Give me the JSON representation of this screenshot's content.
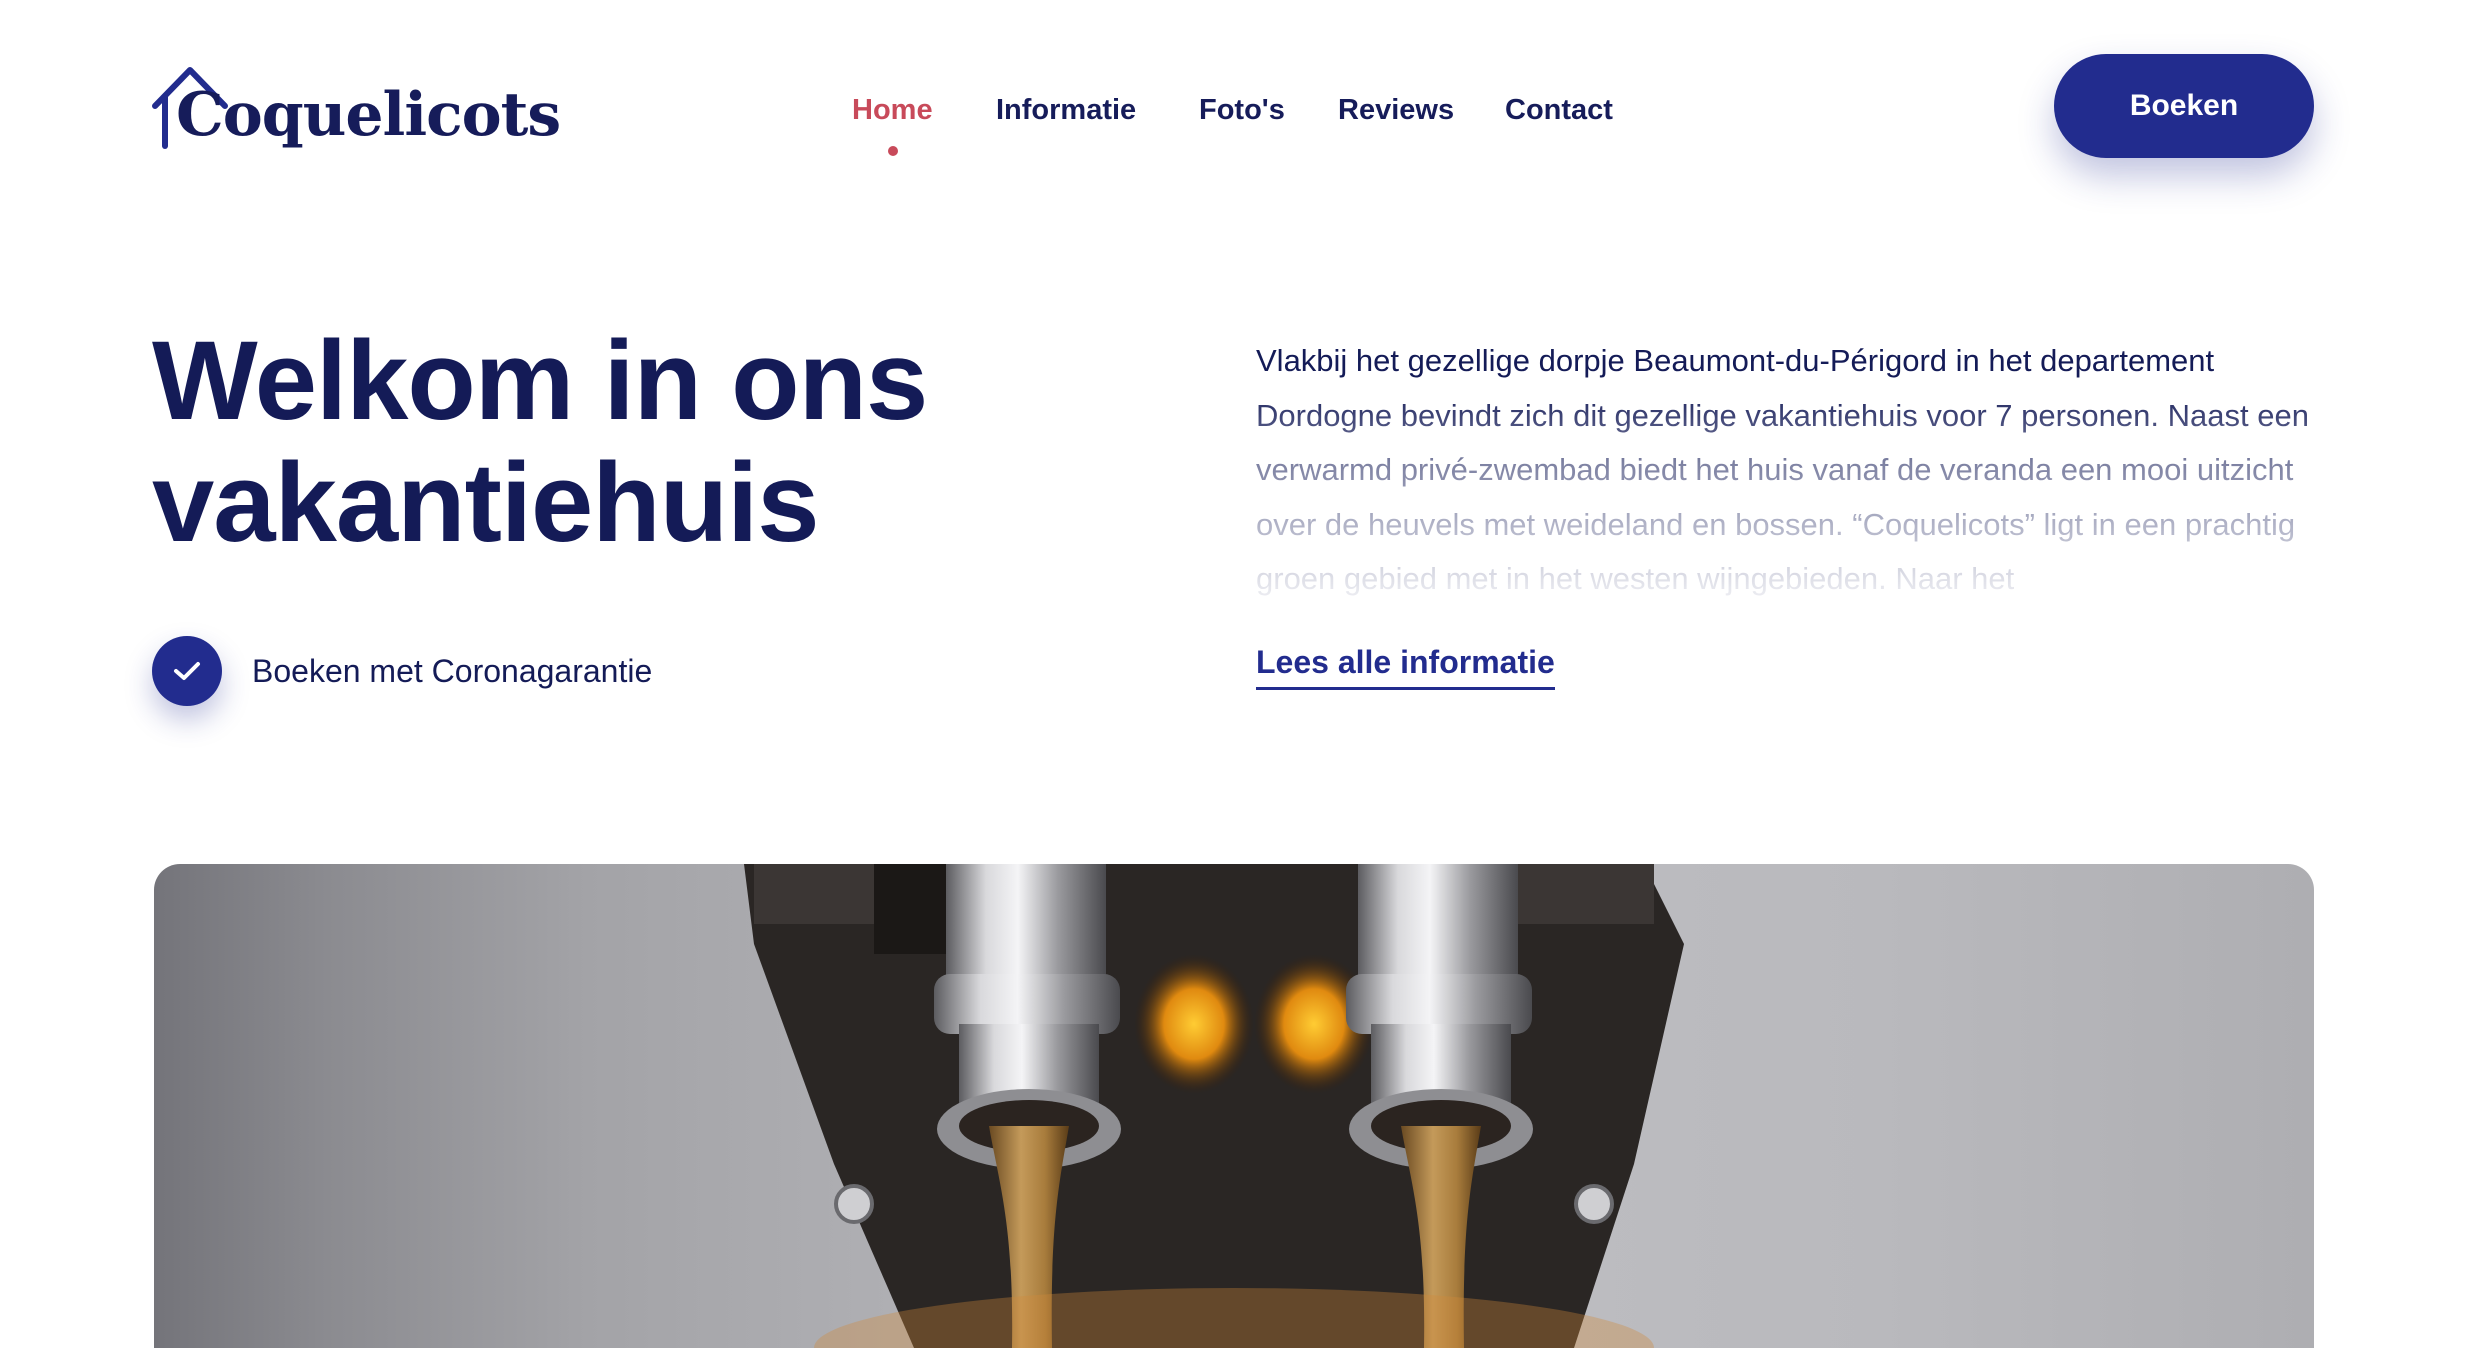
{
  "header": {
    "logo_text": "Coquelicots",
    "nav": [
      {
        "label": "Home",
        "active": true
      },
      {
        "label": "Informatie",
        "active": false
      },
      {
        "label": "Foto's",
        "active": false
      },
      {
        "label": "Reviews",
        "active": false
      },
      {
        "label": "Contact",
        "active": false
      }
    ],
    "book_label": "Boeken"
  },
  "hero": {
    "title": "Welkom in ons vakantiehuis",
    "guarantee_label": "Boeken met Coronagarantie",
    "intro": "Vlakbij het gezellige dorpje Beaumont-du-Périgord in het departement Dordogne bevindt zich dit gezellige vakantiehuis voor 7 personen. Naast een verwarmd privé-zwembad biedt het huis vanaf de veranda een mooi uitzicht over de heuvels met weideland en bossen. “Coquelicots” ligt in een prachtig groen gebied met in het westen wijngebieden. Naar het",
    "read_more_label": "Lees alle informatie"
  },
  "icons": {
    "logo": "house-icon",
    "guarantee": "check-icon"
  },
  "colors": {
    "primary": "#222c8e",
    "heading": "#141b57",
    "accent": "#c84a5a"
  }
}
